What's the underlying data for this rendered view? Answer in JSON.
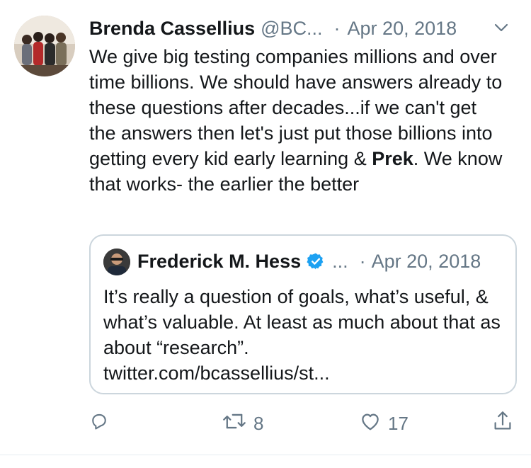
{
  "author": {
    "name": "Brenda Cassellius",
    "handle": "@BC...",
    "separator": "·",
    "date": "Apr 20, 2018"
  },
  "tweet": {
    "text_before": "We give big testing companies millions and over time billions. We should have answers already to these questions after decades...if we can't get the answers then let's just put those billions into getting every kid early learning & ",
    "text_bold": "Prek",
    "text_after": ". We know that works- the earlier the better"
  },
  "quoted": {
    "name": "Frederick M. Hess",
    "ellipsis": "...",
    "separator": "·",
    "date": "Apr 20, 2018",
    "text": "It’s really a question of goals, what’s useful, & what’s valuable. At least as much about that as about “research”.\ntwitter.com/bcassellius/st..."
  },
  "actions": {
    "reply_icon": "reply-icon",
    "retweet_count": "8",
    "like_count": "17",
    "share_icon": "share-icon"
  },
  "colors": {
    "text": "#14171a",
    "muted": "#657786",
    "border": "#ccd6dd",
    "verified": "#1da1f2"
  }
}
